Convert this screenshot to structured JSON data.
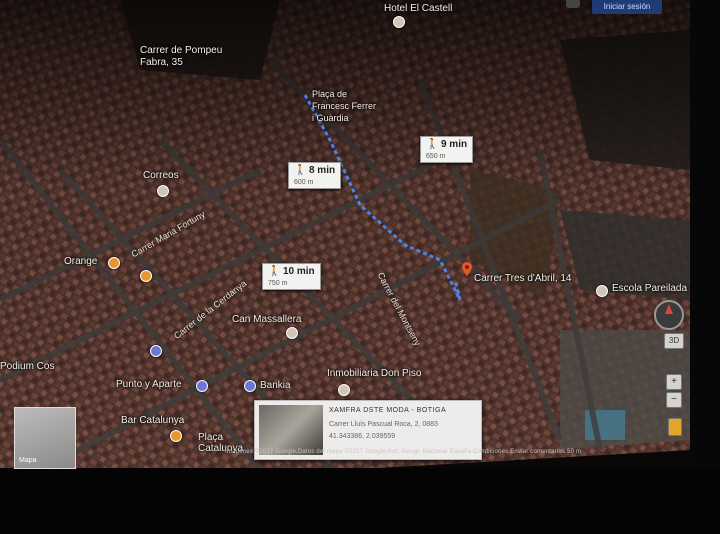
{
  "header": {
    "signin_label": "Iniciar sesión"
  },
  "places": {
    "hotel": "Hotel El Castell",
    "pompeu": "Carrer de Pompeu Fabra, 35",
    "placa_francesc": "Plaça de Francesc Ferrer i Guàrdia",
    "correos": "Correos",
    "orange": "Orange",
    "can_massallera": "Can Massallera",
    "podium": "Podium Cos",
    "punto": "Punto y Aparte",
    "bankia": "Bankia",
    "inmobiliaria": "Inmobiliaria Don Piso",
    "bar": "Bar Catalunya",
    "placa_cat": "Plaça Catalunya",
    "escola": "Escola Pareilada",
    "destination": "Carrer Tres d'Abril, 14"
  },
  "streets": {
    "s1": "Carrer Maria Fortuny",
    "s2": "Carrer de la Cerdanya",
    "s3": "Carrer del Montseny"
  },
  "routes": [
    {
      "time": "8 min",
      "distance": "600 m"
    },
    {
      "time": "9 min",
      "distance": "650 m"
    },
    {
      "time": "10 min",
      "distance": "750 m"
    }
  ],
  "card": {
    "title": "XAMFRA DSTE MODA - BOTIGA",
    "address": "Carrer Lluís Pascual Roca, 2, 0883",
    "coords": "41.343386, 2.039559"
  },
  "map_thumb": {
    "label": "Mapa"
  },
  "footer": "Imágenes ©2017 Google,Datos del mapa ©2017 Google,Inst. Geogr. Nacional     España     Condiciones     Enviar comentarios     50 m",
  "controls": {
    "zoom_in": "+",
    "zoom_out": "−",
    "tilt": "3D"
  },
  "colors": {
    "route": "#4a8cff",
    "pin": "#e4572e",
    "signin": "#1f3b76"
  }
}
